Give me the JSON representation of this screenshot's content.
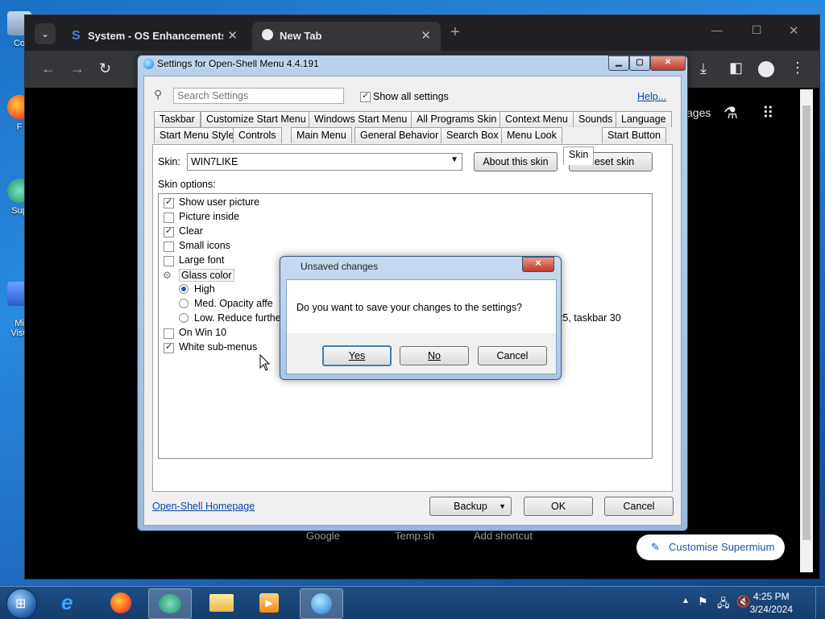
{
  "desktop": {
    "icons": [
      "Co",
      "F",
      "Sup",
      "Mi\nVisu"
    ]
  },
  "browser": {
    "tabs": [
      {
        "title": "System - OS Enhancements Do",
        "close": "✕"
      },
      {
        "title": "New Tab",
        "close": "✕"
      }
    ],
    "new_tab": "+",
    "window_controls": {
      "minimize": "—",
      "maximize": "☐",
      "close": "✕"
    },
    "page_fragments": {
      "images_link": "ages",
      "shortcut_google": "Google",
      "shortcut_temp": "Temp.sh",
      "shortcut_add": "Add shortcut",
      "customise": "Customise Supermium"
    }
  },
  "settings": {
    "title": "Settings for Open-Shell Menu 4.4.191",
    "search_placeholder": "Search Settings",
    "show_all_label": "Show all settings",
    "help_link": "Help...",
    "tabs_row1": [
      "Taskbar",
      "Customize Start Menu",
      "Windows Start Menu",
      "All Programs Skin",
      "Context Menu",
      "Sounds",
      "Language"
    ],
    "tabs_row2": [
      "Start Menu Style",
      "Controls",
      "Main Menu",
      "General Behavior",
      "Search Box",
      "Menu Look",
      "Skin",
      "Start Button"
    ],
    "skin_label": "Skin:",
    "skin_value": "WIN7LIKE",
    "about_skin": "About this skin",
    "reset_skin": "Reset skin",
    "skin_options_label": "Skin options:",
    "options": [
      {
        "label": "Show user picture",
        "checked": true
      },
      {
        "label": "Picture inside",
        "checked": false
      },
      {
        "label": "Clear",
        "checked": true
      },
      {
        "label": "Small icons",
        "checked": false
      },
      {
        "label": "Large font",
        "checked": false
      },
      {
        "label": "Glass color",
        "checked": false
      }
    ],
    "radios": [
      {
        "label": "High",
        "selected": true
      },
      {
        "label": "Med.  Opacity affe",
        "selected": false
      },
      {
        "label": "Low.   Reduce furthe",
        "selected": false
      }
    ],
    "radio_tail": "u 25, taskbar 30",
    "options2": [
      {
        "label": "On Win 10",
        "checked": false
      },
      {
        "label": "White sub-menus",
        "checked": true
      }
    ],
    "homepage_link": "Open-Shell Homepage",
    "backup": "Backup",
    "ok": "OK",
    "cancel": "Cancel"
  },
  "dialog": {
    "title": "Unsaved changes",
    "message": "Do you want to save your changes to the settings?",
    "yes": "Yes",
    "no": "No",
    "cancel": "Cancel"
  },
  "taskbar": {
    "time": "4:25 PM",
    "date": "3/24/2024"
  },
  "colors": {
    "accent": "#1a55a8",
    "desktop": "#1a6fc4",
    "browser_frame": "#202124"
  }
}
